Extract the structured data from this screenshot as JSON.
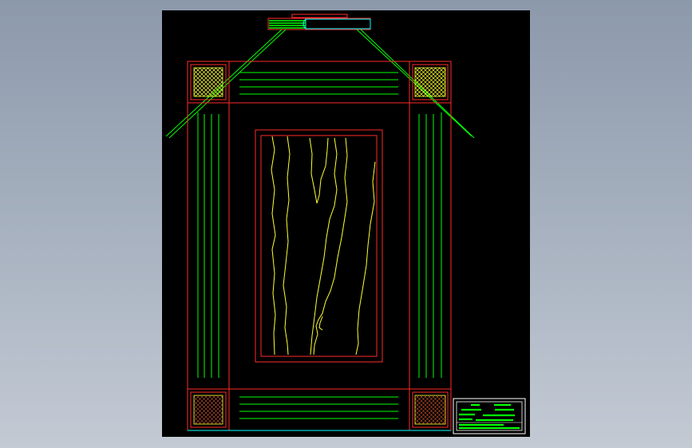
{
  "drawing": {
    "background": "#000000",
    "viewport_background": [
      "#8c99ab",
      "#c3cad4"
    ],
    "line_colors": {
      "frame": "#ff2a2a",
      "bead": "#00ff00",
      "grain": "#ffff33",
      "edge": "#00ffff",
      "hatch": "#ffff33"
    },
    "hatch_pattern": "cross-hatch",
    "title_block": {
      "lines": [
        "",
        "",
        "",
        ""
      ]
    }
  }
}
